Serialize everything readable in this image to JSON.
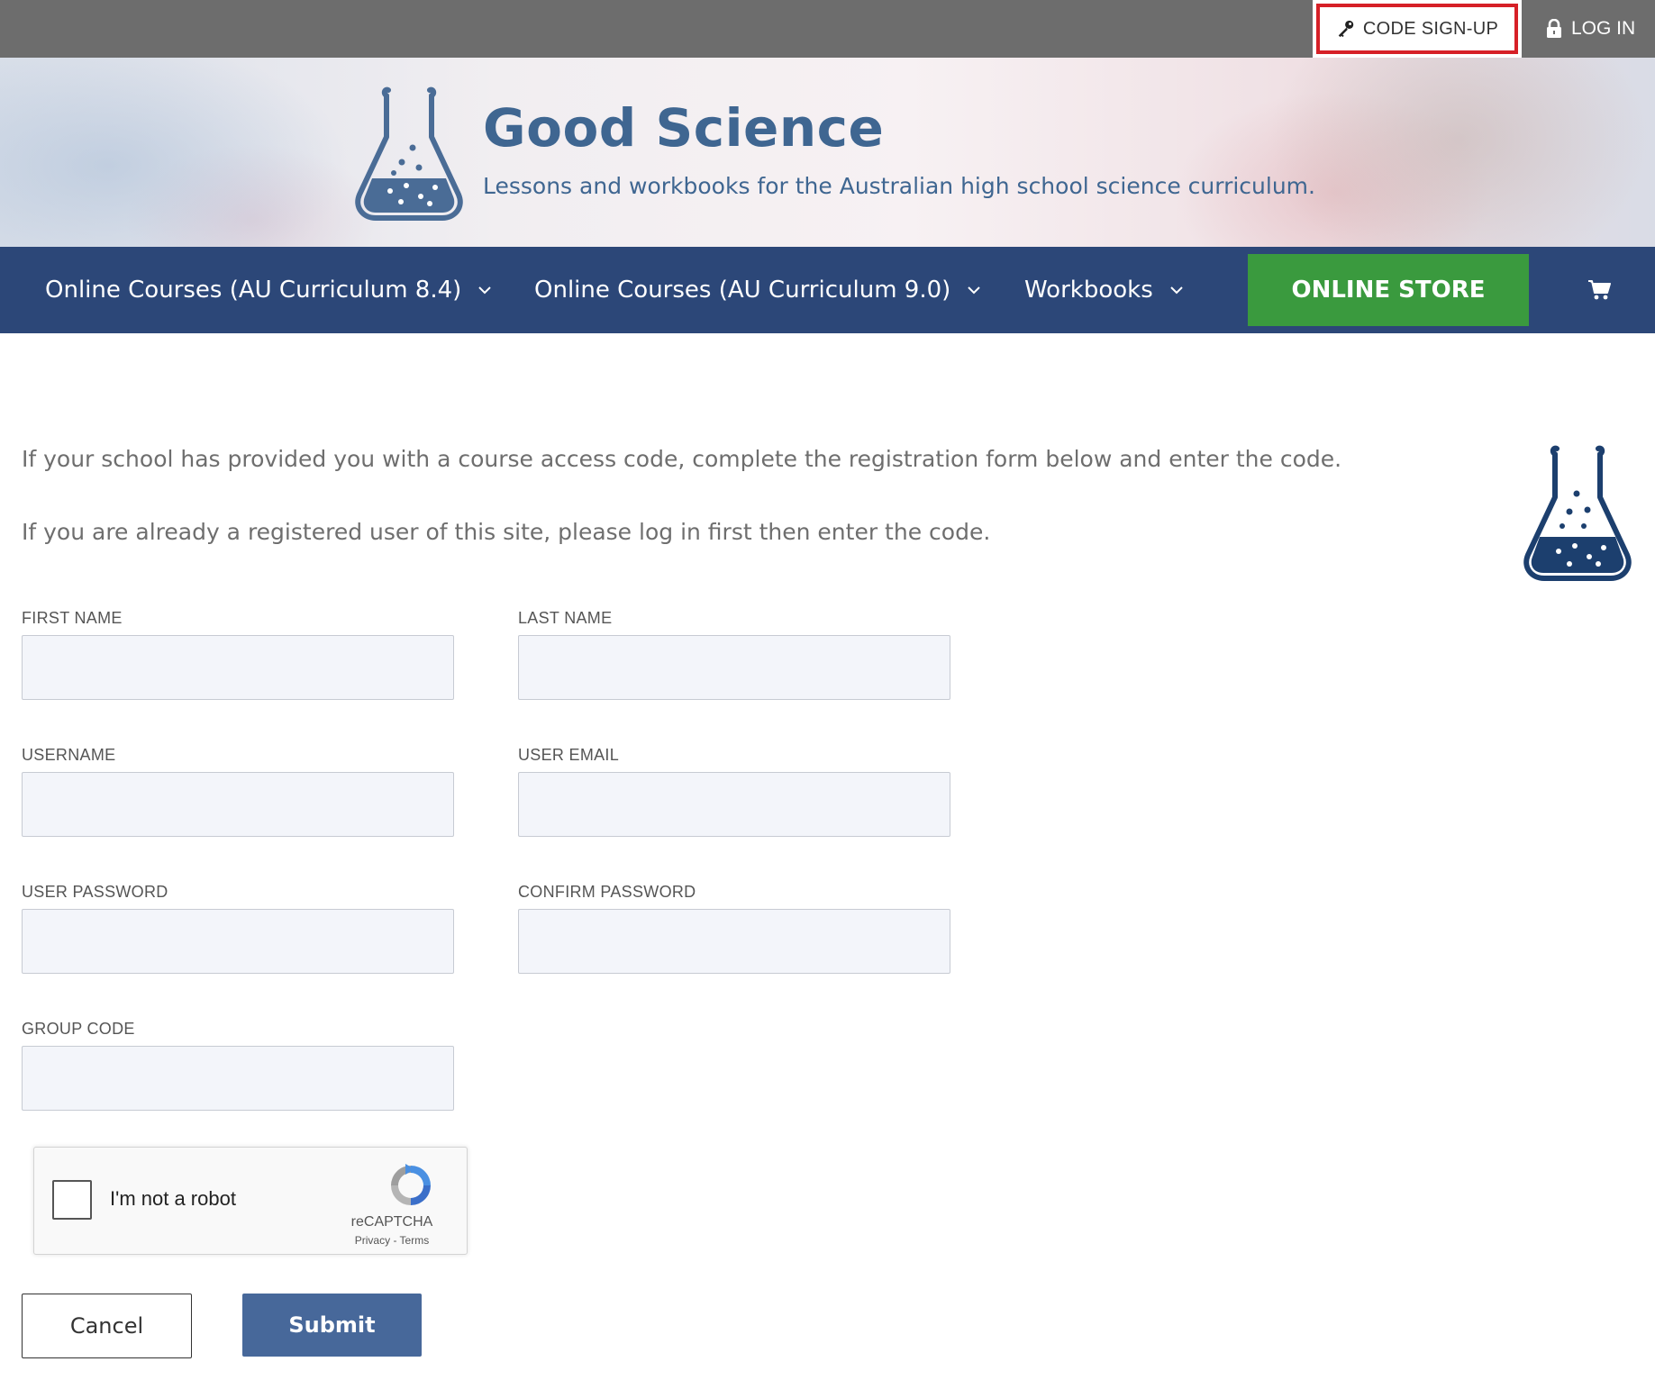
{
  "topbar": {
    "code_signup_label": "CODE SIGN-UP",
    "login_label": "LOG IN",
    "icons": {
      "code_signup": "key-icon",
      "login": "lock-icon"
    },
    "highlight_color": "#d62027"
  },
  "banner": {
    "title": "Good Science",
    "tagline": "Lessons and workbooks for the Australian high school science curriculum."
  },
  "nav": {
    "items": [
      {
        "label": "Online Courses (AU Curriculum 8.4)"
      },
      {
        "label": "Online Courses (AU Curriculum 9.0)"
      },
      {
        "label": "Workbooks"
      }
    ],
    "store_label": "ONLINE STORE",
    "store_color": "#3a9a3e",
    "nav_color": "#2c4778"
  },
  "intro": {
    "line1": "If your school has provided you with a course access code, complete the registration form below and enter the code.",
    "line2": "If you are already a registered user of this site, please log in first then enter the code."
  },
  "form": {
    "first_name": {
      "label": "FIRST NAME",
      "value": ""
    },
    "last_name": {
      "label": "LAST NAME",
      "value": ""
    },
    "username": {
      "label": "USERNAME",
      "value": ""
    },
    "user_email": {
      "label": "USER EMAIL",
      "value": ""
    },
    "user_password": {
      "label": "USER PASSWORD",
      "value": ""
    },
    "confirm_password": {
      "label": "CONFIRM PASSWORD",
      "value": ""
    },
    "group_code": {
      "label": "GROUP CODE",
      "value": ""
    }
  },
  "captcha": {
    "label": "I'm not a robot",
    "brand": "reCAPTCHA",
    "links": "Privacy - Terms"
  },
  "buttons": {
    "cancel": "Cancel",
    "submit": "Submit",
    "submit_color": "#47689a"
  }
}
